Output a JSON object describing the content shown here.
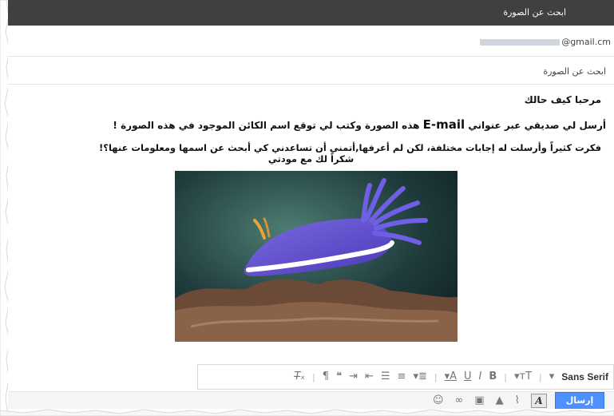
{
  "window": {
    "title": "ابحث عن الصورة"
  },
  "recipient": {
    "email_suffix": "@gmail.cm"
  },
  "subject": {
    "value": "ابحث عن الصورة"
  },
  "message": {
    "greeting": "مرحبا كيف حالك",
    "line1_before": "أرسل لي صديقي عبر عنواني",
    "line1_email": "E-mail",
    "line1_after": "هذه الصورة وكتب لي توقع اسم الكائن الموجود في هذه الصورة !",
    "line2": "فكرت كثيراً وأرسلت له إجابات مختلفة، لكن لم أعرفها,أتمنى أن تساعدني كي أبحث عن اسمها ومعلومات عنها؟!",
    "line3": "شكراً لك مع مودتي"
  },
  "format_bar": {
    "font": "Sans Serif",
    "icons": [
      "remove-formatting-icon",
      "rtl-icon",
      "quote-icon",
      "indent-more-icon",
      "indent-less-icon",
      "bulleted-list-icon",
      "numbered-list-icon",
      "align-icon",
      "text-color-icon",
      "underline-icon",
      "italic-icon",
      "bold-icon",
      "font-size-icon"
    ]
  },
  "bottom_bar": {
    "send_label": "إرسال",
    "icons": [
      "emoji-icon",
      "link-icon",
      "photo-icon",
      "drive-icon",
      "attach-icon",
      "formatting-toggle-icon"
    ]
  },
  "colors": {
    "titlebar": "#404040",
    "send_button": "#4d90fe",
    "nudibranch": "#6a5ad0"
  }
}
